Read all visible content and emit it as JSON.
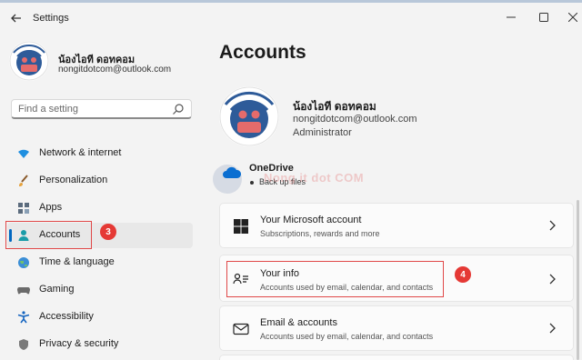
{
  "window": {
    "title": "Settings",
    "back_icon": "back-arrow-icon",
    "controls": [
      "minimize",
      "maximize",
      "close"
    ]
  },
  "profile": {
    "name": "น้องไอที ดอทคอม",
    "email": "nongitdotcom@outlook.com",
    "role": "Administrator"
  },
  "search": {
    "placeholder": "Find a setting"
  },
  "nav": {
    "items": [
      {
        "label": "Network & internet",
        "icon": "wifi-icon"
      },
      {
        "label": "Personalization",
        "icon": "brush-icon"
      },
      {
        "label": "Apps",
        "icon": "apps-icon"
      },
      {
        "label": "Accounts",
        "icon": "person-icon",
        "selected": true
      },
      {
        "label": "Time & language",
        "icon": "globe-icon"
      },
      {
        "label": "Gaming",
        "icon": "gamepad-icon"
      },
      {
        "label": "Accessibility",
        "icon": "accessibility-icon"
      },
      {
        "label": "Privacy & security",
        "icon": "shield-icon"
      }
    ]
  },
  "main": {
    "title": "Accounts",
    "onedrive": {
      "title": "OneDrive",
      "subtitle": "Back up files"
    },
    "cards": [
      {
        "title": "Your Microsoft account",
        "subtitle": "Subscriptions, rewards and more",
        "icon": "windows-logo-icon"
      },
      {
        "title": "Your info",
        "subtitle": "Accounts used by email, calendar, and contacts",
        "icon": "person-card-icon"
      },
      {
        "title": "Email & accounts",
        "subtitle": "Accounts used by email, calendar, and contacts",
        "icon": "mail-icon"
      }
    ]
  },
  "annotations": {
    "step_accounts": "3",
    "step_your_info": "4"
  },
  "watermark": {
    "text": "Nong it dot COM"
  },
  "colors": {
    "accent": "#0067c0",
    "highlight_box": "#e04848",
    "badge": "#e53935",
    "background": "#f3f3f3"
  }
}
